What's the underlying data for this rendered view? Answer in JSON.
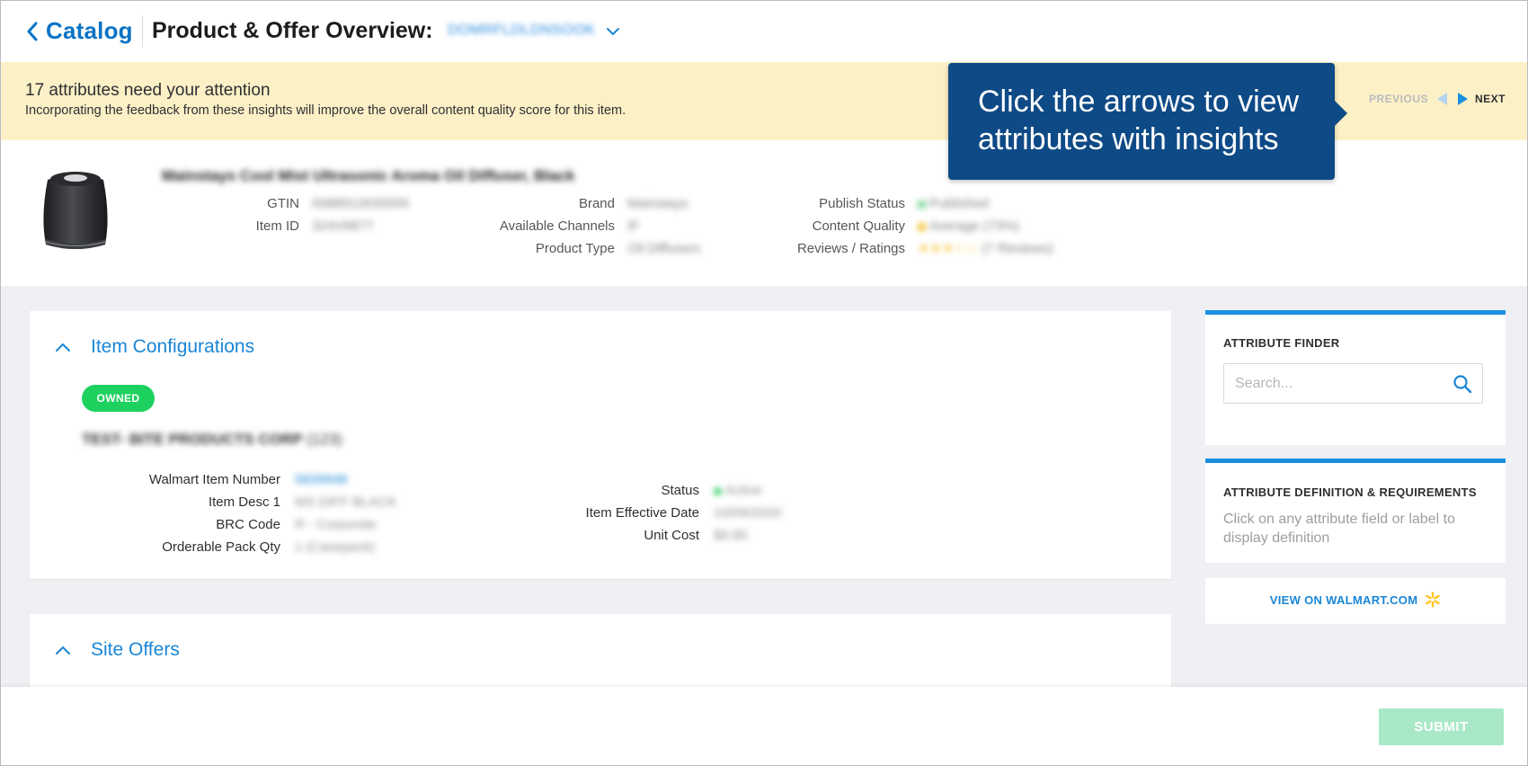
{
  "header": {
    "back_label": "Catalog",
    "title": "Product & Offer Overview:",
    "item_selector_value": "DOMRFLDLDNSOOK"
  },
  "banner": {
    "title": "17 attributes need your attention",
    "subtitle": "Incorporating the feedback from these insights will improve the overall content quality score for this item.",
    "prev_label": "PREVIOUS",
    "next_label": "NEXT"
  },
  "tooltip": {
    "line1": "Click the arrows to view",
    "line2": "attributes with insights"
  },
  "product": {
    "name": "Mainstays Cool Mist Ultrasonic Aroma Oil Diffuser, Black",
    "col1": [
      {
        "label": "GTIN",
        "value": "0088912635555"
      },
      {
        "label": "Item ID",
        "value": "324V6877"
      }
    ],
    "col2": [
      {
        "label": "Brand",
        "value": "Mainstays"
      },
      {
        "label": "Available Channels",
        "value": "IF"
      },
      {
        "label": "Product Type",
        "value": "Oil Diffusers"
      }
    ],
    "col3": [
      {
        "label": "Publish Status",
        "value": "Published",
        "dot_color": "#7ed99a"
      },
      {
        "label": "Content Quality",
        "value": "Average (73%)",
        "dot_color": "#f5c842"
      },
      {
        "label": "Reviews / Ratings",
        "value": "(7 Reviews)",
        "stars": "★★★☆☆"
      }
    ]
  },
  "item_configurations": {
    "title": "Item Configurations",
    "badge": "OWNED",
    "org_name": "TEST- BITE PRODUCTS CORP",
    "org_id": "(123)",
    "left_fields": [
      {
        "label": "Walmart Item Number",
        "value": "5839948"
      },
      {
        "label": "Item Desc 1",
        "value": "MS DIFF BLACK"
      },
      {
        "label": "BRC Code",
        "value": "R - Corporate"
      },
      {
        "label": "Orderable Pack Qty",
        "value": "1 (Casepack)"
      }
    ],
    "right_fields": [
      {
        "label": "Status",
        "value": "Active",
        "dot_color": "#3fcf6b"
      },
      {
        "label": "Item Effective Date",
        "value": "10/09/2020"
      },
      {
        "label": "Unit Cost",
        "value": "$9.85"
      }
    ]
  },
  "site_offers": {
    "title": "Site Offers"
  },
  "attribute_finder": {
    "title": "ATTRIBUTE FINDER",
    "search_placeholder": "Search..."
  },
  "attribute_definition": {
    "title": "ATTRIBUTE DEFINITION & REQUIREMENTS",
    "description": "Click on any attribute field or label to display definition"
  },
  "view_on_walmart": "VIEW ON WALMART.COM",
  "footer": {
    "submit_label": "SUBMIT"
  },
  "colors": {
    "accent": "#1a86d6",
    "banner_bg": "#fcf0c6",
    "tooltip_bg": "#0e4a86",
    "owned_badge": "#1dd15f",
    "submit_disabled": "#a9e8c7"
  }
}
